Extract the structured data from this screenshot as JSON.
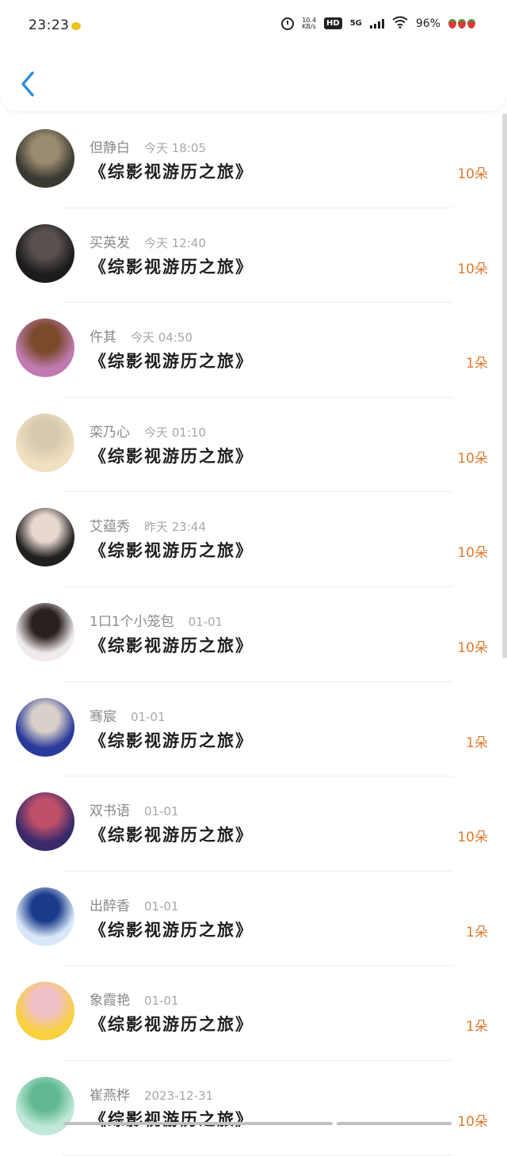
{
  "status_bar": {
    "time": "23:23",
    "net_speed_value": "10.4",
    "net_speed_unit": "KB/s",
    "hd": "HD",
    "network": "5G",
    "battery": "96%"
  },
  "header": {
    "back_icon": "chevron-left-icon"
  },
  "colors": {
    "accent": "#2e8fdc",
    "amount": "#e07a2e"
  },
  "gifts": [
    {
      "name": "但静白",
      "time": "今天 18:05",
      "title": "《综影视游历之旅》",
      "amount": "10朵",
      "avatar_colors": [
        "#3a3a32",
        "#9a8a70"
      ]
    },
    {
      "name": "买英发",
      "time": "今天 12:40",
      "title": "《综影视游历之旅》",
      "amount": "10朵",
      "avatar_colors": [
        "#1c1c1c",
        "#5a5050"
      ]
    },
    {
      "name": "仵其",
      "time": "今天 04:50",
      "title": "《综影视游历之旅》",
      "amount": "1朵",
      "avatar_colors": [
        "#c07ab0",
        "#7a4a2a"
      ]
    },
    {
      "name": "栾乃心",
      "time": "今天 01:10",
      "title": "《综影视游历之旅》",
      "amount": "10朵",
      "avatar_colors": [
        "#f0e0c0",
        "#d8c8b0"
      ]
    },
    {
      "name": "艾蕴秀",
      "time": "昨天 23:44",
      "title": "《综影视游历之旅》",
      "amount": "10朵",
      "avatar_colors": [
        "#202020",
        "#e8d8d0"
      ]
    },
    {
      "name": "1口1个小笼包",
      "time": "01-01",
      "title": "《综影视游历之旅》",
      "amount": "10朵",
      "avatar_colors": [
        "#f0eaea",
        "#2a2020"
      ]
    },
    {
      "name": "骞宸",
      "time": "01-01",
      "title": "《综影视游历之旅》",
      "amount": "1朵",
      "avatar_colors": [
        "#2a3a9a",
        "#d8d0c8"
      ]
    },
    {
      "name": "双书语",
      "time": "01-01",
      "title": "《综影视游历之旅》",
      "amount": "10朵",
      "avatar_colors": [
        "#3a2a6a",
        "#c0506a"
      ]
    },
    {
      "name": "出醉香",
      "time": "01-01",
      "title": "《综影视游历之旅》",
      "amount": "1朵",
      "avatar_colors": [
        "#d8e8f8",
        "#1a3a8a"
      ]
    },
    {
      "name": "象霞艳",
      "time": "01-01",
      "title": "《综影视游历之旅》",
      "amount": "1朵",
      "avatar_colors": [
        "#f8d040",
        "#f0c0c8"
      ]
    },
    {
      "name": "崔燕桦",
      "time": "2023-12-31",
      "title": "《综影视游历之旅》",
      "amount": "10朵",
      "avatar_colors": [
        "#bfe8d8",
        "#60b890"
      ]
    }
  ]
}
